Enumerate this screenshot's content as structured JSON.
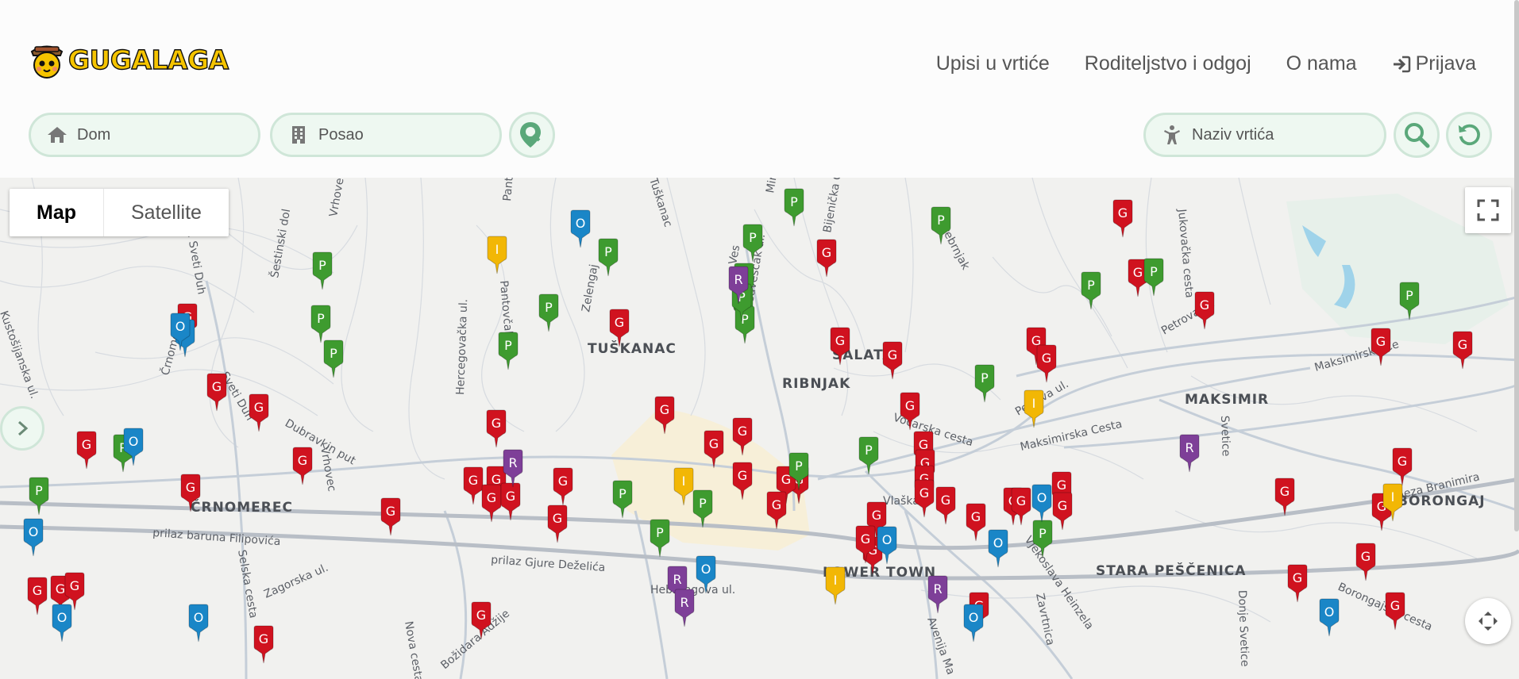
{
  "brand": {
    "name": "GUGALAGA"
  },
  "nav": {
    "items": [
      {
        "label": "Upisi u vrtiće"
      },
      {
        "label": "Roditeljstvo i odgoj"
      },
      {
        "label": "O nama"
      },
      {
        "label": "Prijava"
      }
    ]
  },
  "search": {
    "home_placeholder": "Dom",
    "work_placeholder": "Posao",
    "kindergarten_placeholder": "Naziv vrtića"
  },
  "map": {
    "type_control": {
      "map_label": "Map",
      "satellite_label": "Satellite",
      "selected": "Map"
    },
    "districts": [
      "TUŠKANAC",
      "ŠALATA",
      "RIBNJAK",
      "MAKSIMIR",
      "ČRNOMEREC",
      "LOWER TOWN",
      "STARA PEŠČENICA",
      "BORONGAJ"
    ],
    "streets": [
      "Maksimirska Cesta",
      "Petrova ul.",
      "Vočarska cesta",
      "Vlaška",
      "Hebrangova ul.",
      "prilaz Gjure Deželića",
      "prilaz baruna Filipovića",
      "Vjekoslava Heinzela",
      "Zagorska ul.",
      "Selska cesta",
      "Nova cesta",
      "Ul. kneza Branimira",
      "Borongajska cesta",
      "Avenija Ma",
      "Zavrtnica",
      "Donje Svetice",
      "Svetice",
      "Srebrnjak",
      "Bijenička ce",
      "Medveščak ul.",
      "Zelengaj",
      "Tuškanac",
      "Pantovčak",
      "Hercegovačka ul.",
      "Vrhovec",
      "Šestinski dol",
      "Ul. Sveti Duh",
      "Sveti Duh",
      "Črnomerec",
      "Kustošijanska ul.",
      "Maksimirska Ce",
      "Dubravkin put",
      "Vrhove",
      "Božidara Adžije",
      "Jukovačka cesta",
      "Mir",
      "Ves"
    ],
    "marker_types": {
      "G": {
        "color": "#d0121f"
      },
      "P": {
        "color": "#3e9b2f"
      },
      "O": {
        "color": "#1a86c7"
      },
      "R": {
        "color": "#7e3f98"
      },
      "I": {
        "color": "#f2b705"
      }
    },
    "markers": [
      {
        "letter": "G",
        "type": "G"
      },
      {
        "letter": "G",
        "type": "G"
      },
      {
        "letter": "G",
        "type": "G"
      },
      {
        "letter": "G",
        "type": "G"
      },
      {
        "letter": "G",
        "type": "G"
      },
      {
        "letter": "G",
        "type": "G"
      },
      {
        "letter": "G",
        "type": "G"
      },
      {
        "letter": "G",
        "type": "G"
      },
      {
        "letter": "G",
        "type": "G"
      },
      {
        "letter": "G",
        "type": "G"
      },
      {
        "letter": "G",
        "type": "G"
      },
      {
        "letter": "G",
        "type": "G"
      },
      {
        "letter": "G",
        "type": "G"
      },
      {
        "letter": "G",
        "type": "G"
      },
      {
        "letter": "G",
        "type": "G"
      },
      {
        "letter": "G",
        "type": "G"
      },
      {
        "letter": "G",
        "type": "G"
      },
      {
        "letter": "G",
        "type": "G"
      },
      {
        "letter": "G",
        "type": "G"
      },
      {
        "letter": "G",
        "type": "G"
      },
      {
        "letter": "G",
        "type": "G"
      },
      {
        "letter": "G",
        "type": "G"
      },
      {
        "letter": "G",
        "type": "G"
      },
      {
        "letter": "G",
        "type": "G"
      },
      {
        "letter": "G",
        "type": "G"
      },
      {
        "letter": "G",
        "type": "G"
      },
      {
        "letter": "G",
        "type": "G"
      },
      {
        "letter": "G",
        "type": "G"
      },
      {
        "letter": "G",
        "type": "G"
      },
      {
        "letter": "G",
        "type": "G"
      },
      {
        "letter": "G",
        "type": "G"
      },
      {
        "letter": "G",
        "type": "G"
      },
      {
        "letter": "G",
        "type": "G"
      },
      {
        "letter": "G",
        "type": "G"
      },
      {
        "letter": "G",
        "type": "G"
      },
      {
        "letter": "G",
        "type": "G"
      },
      {
        "letter": "G",
        "type": "G"
      },
      {
        "letter": "G",
        "type": "G"
      },
      {
        "letter": "G",
        "type": "G"
      },
      {
        "letter": "G",
        "type": "G"
      },
      {
        "letter": "G",
        "type": "G"
      },
      {
        "letter": "G",
        "type": "G"
      },
      {
        "letter": "G",
        "type": "G"
      },
      {
        "letter": "G",
        "type": "G"
      },
      {
        "letter": "G",
        "type": "G"
      },
      {
        "letter": "G",
        "type": "G"
      },
      {
        "letter": "G",
        "type": "G"
      },
      {
        "letter": "G",
        "type": "G"
      },
      {
        "letter": "G",
        "type": "G"
      },
      {
        "letter": "G",
        "type": "G"
      },
      {
        "letter": "G",
        "type": "G"
      },
      {
        "letter": "G",
        "type": "G"
      },
      {
        "letter": "G",
        "type": "G"
      },
      {
        "letter": "G",
        "type": "G"
      },
      {
        "letter": "G",
        "type": "G"
      },
      {
        "letter": "G",
        "type": "G"
      },
      {
        "letter": "G",
        "type": "G"
      },
      {
        "letter": "G",
        "type": "G"
      },
      {
        "letter": "P",
        "type": "P"
      },
      {
        "letter": "P",
        "type": "P"
      },
      {
        "letter": "P",
        "type": "P"
      },
      {
        "letter": "P",
        "type": "P"
      },
      {
        "letter": "P",
        "type": "P"
      },
      {
        "letter": "P",
        "type": "P"
      },
      {
        "letter": "P",
        "type": "P"
      },
      {
        "letter": "P",
        "type": "P"
      },
      {
        "letter": "P",
        "type": "P"
      },
      {
        "letter": "P",
        "type": "P"
      },
      {
        "letter": "P",
        "type": "P"
      },
      {
        "letter": "P",
        "type": "P"
      },
      {
        "letter": "P",
        "type": "P"
      },
      {
        "letter": "P",
        "type": "P"
      },
      {
        "letter": "P",
        "type": "P"
      },
      {
        "letter": "P",
        "type": "P"
      },
      {
        "letter": "P",
        "type": "P"
      },
      {
        "letter": "P",
        "type": "P"
      },
      {
        "letter": "P",
        "type": "P"
      },
      {
        "letter": "P",
        "type": "P"
      },
      {
        "letter": "P",
        "type": "P"
      },
      {
        "letter": "P",
        "type": "P"
      },
      {
        "letter": "P",
        "type": "P"
      },
      {
        "letter": "P",
        "type": "P"
      },
      {
        "letter": "P",
        "type": "P"
      },
      {
        "letter": "O",
        "type": "O"
      },
      {
        "letter": "O",
        "type": "O"
      },
      {
        "letter": "O",
        "type": "O"
      },
      {
        "letter": "O",
        "type": "O"
      },
      {
        "letter": "O",
        "type": "O"
      },
      {
        "letter": "O",
        "type": "O"
      },
      {
        "letter": "O",
        "type": "O"
      },
      {
        "letter": "O",
        "type": "O"
      },
      {
        "letter": "O",
        "type": "O"
      },
      {
        "letter": "O",
        "type": "O"
      },
      {
        "letter": "O",
        "type": "O"
      },
      {
        "letter": "O",
        "type": "O"
      },
      {
        "letter": "O",
        "type": "O"
      },
      {
        "letter": "R",
        "type": "R"
      },
      {
        "letter": "R",
        "type": "R"
      },
      {
        "letter": "R",
        "type": "R"
      },
      {
        "letter": "R",
        "type": "R"
      },
      {
        "letter": "R",
        "type": "R"
      },
      {
        "letter": "R",
        "type": "R"
      },
      {
        "letter": "I",
        "type": "I"
      },
      {
        "letter": "I",
        "type": "I"
      },
      {
        "letter": "I",
        "type": "I"
      },
      {
        "letter": "I",
        "type": "I"
      },
      {
        "letter": "I",
        "type": "I"
      }
    ]
  }
}
